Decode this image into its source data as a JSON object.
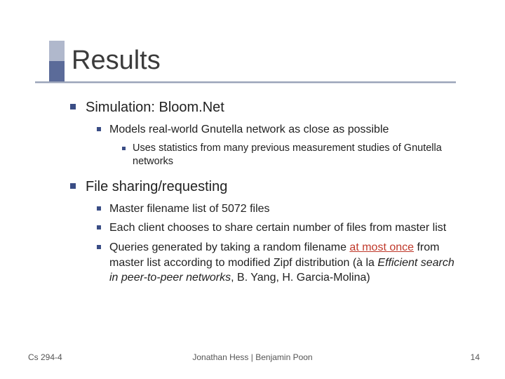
{
  "title": "Results",
  "bullets": {
    "b1": "Simulation: Bloom.Net",
    "b1_1": "Models real-world Gnutella network as close as possible",
    "b1_1_1": "Uses statistics from many previous measurement studies of Gnutella networks",
    "b2": "File sharing/requesting",
    "b2_1": "Master filename list of 5072 files",
    "b2_2": "Each client chooses to share certain number of files from master list",
    "b2_3_pre": "Queries generated by taking a random filename ",
    "b2_3_hl": "at most once",
    "b2_3_mid": " from master list according to modified Zipf distribution (à la ",
    "b2_3_it": "Efficient search in peer-to-peer networks",
    "b2_3_post": ", B. Yang, H. Garcia-Molina)"
  },
  "footer": {
    "left": "Cs 294-4",
    "center": "Jonathan Hess | Benjamin Poon",
    "page": "14"
  }
}
